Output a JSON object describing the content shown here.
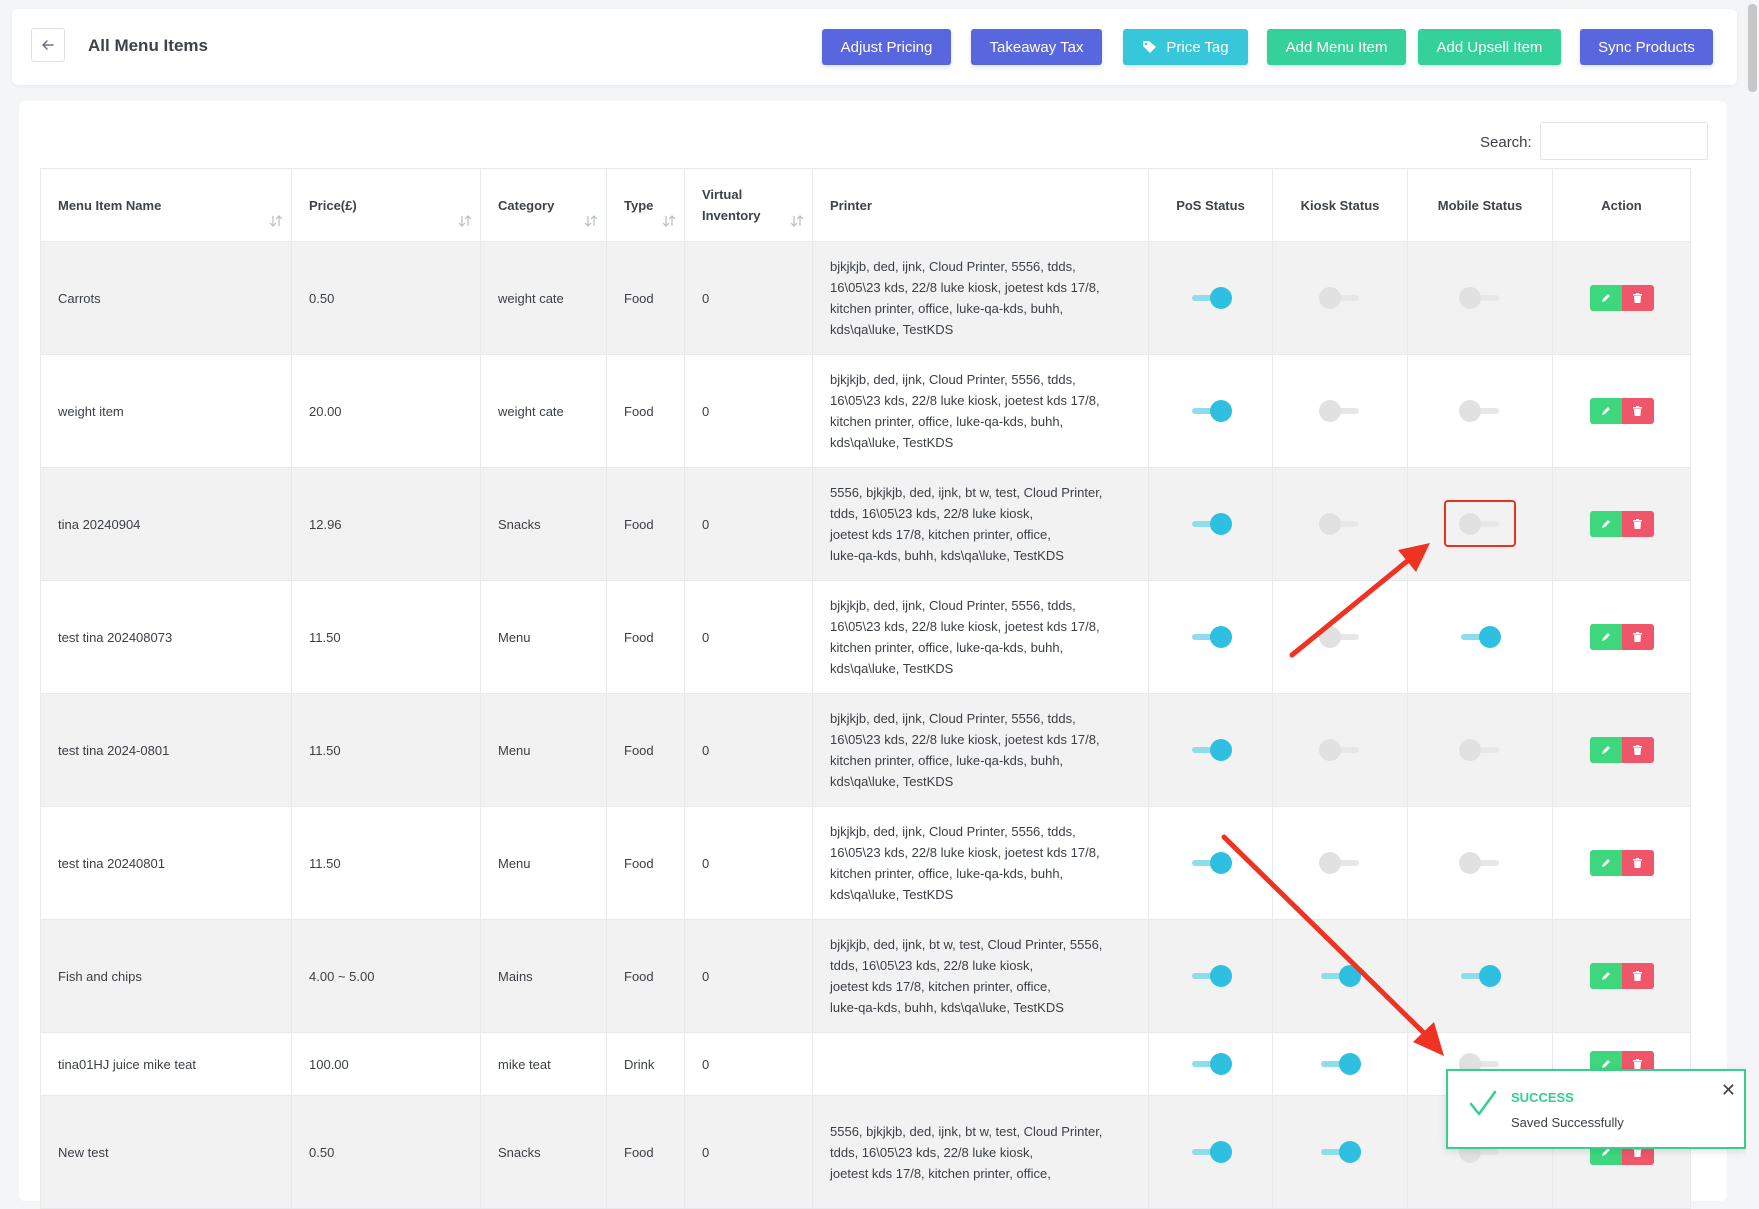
{
  "header": {
    "title": "All Menu Items",
    "buttons": {
      "adjust_pricing": "Adjust Pricing",
      "takeaway_tax": "Takeaway Tax",
      "price_tag": "Price Tag",
      "add_menu_item": "Add Menu Item",
      "add_upsell_item": "Add Upsell Item",
      "sync_products": "Sync Products"
    }
  },
  "search": {
    "label": "Search:",
    "value": ""
  },
  "table": {
    "columns": {
      "name": "Menu Item Name",
      "price": "Price(£)",
      "category": "Category",
      "type": "Type",
      "virtual_inventory_line1": "Virtual",
      "virtual_inventory_line2": "Inventory",
      "printer": "Printer",
      "pos_status": "PoS Status",
      "kiosk_status": "Kiosk Status",
      "mobile_status": "Mobile Status",
      "action": "Action"
    },
    "rows": [
      {
        "name": "Carrots",
        "price": "0.50",
        "category": "weight cate",
        "type": "Food",
        "virtual_inventory": "0",
        "printer_lines": [
          "bjkjkjb, ded, ijnk, Cloud Printer, 5556, tdds,",
          "16\\05\\23 kds, 22/8 luke kiosk, joetest kds 17/8,",
          "kitchen printer, office, luke-qa-kds, buhh,",
          "kds\\qa\\luke, TestKDS"
        ],
        "pos": true,
        "kiosk": false,
        "mobile": false
      },
      {
        "name": "weight item",
        "price": "20.00",
        "category": "weight cate",
        "type": "Food",
        "virtual_inventory": "0",
        "printer_lines": [
          "bjkjkjb, ded, ijnk, Cloud Printer, 5556, tdds,",
          "16\\05\\23 kds, 22/8 luke kiosk, joetest kds 17/8,",
          "kitchen printer, office, luke-qa-kds, buhh,",
          "kds\\qa\\luke, TestKDS"
        ],
        "pos": true,
        "kiosk": false,
        "mobile": false
      },
      {
        "name": "tina 20240904",
        "price": "12.96",
        "category": "Snacks",
        "type": "Food",
        "virtual_inventory": "0",
        "printer_lines": [
          "5556, bjkjkjb, ded, ijnk, bt w, test, Cloud Printer,",
          "tdds, 16\\05\\23 kds, 22/8 luke kiosk,",
          "joetest kds 17/8, kitchen printer, office,",
          "luke-qa-kds, buhh, kds\\qa\\luke, TestKDS"
        ],
        "pos": true,
        "kiosk": false,
        "mobile": false
      },
      {
        "name": "test tina 202408073",
        "price": "11.50",
        "category": "Menu",
        "type": "Food",
        "virtual_inventory": "0",
        "printer_lines": [
          "bjkjkjb, ded, ijnk, Cloud Printer, 5556, tdds,",
          "16\\05\\23 kds, 22/8 luke kiosk, joetest kds 17/8,",
          "kitchen printer, office, luke-qa-kds, buhh,",
          "kds\\qa\\luke, TestKDS"
        ],
        "pos": true,
        "kiosk": false,
        "mobile": true
      },
      {
        "name": "test tina 2024-0801",
        "price": "11.50",
        "category": "Menu",
        "type": "Food",
        "virtual_inventory": "0",
        "printer_lines": [
          "bjkjkjb, ded, ijnk, Cloud Printer, 5556, tdds,",
          "16\\05\\23 kds, 22/8 luke kiosk, joetest kds 17/8,",
          "kitchen printer, office, luke-qa-kds, buhh,",
          "kds\\qa\\luke, TestKDS"
        ],
        "pos": true,
        "kiosk": false,
        "mobile": false
      },
      {
        "name": "test tina 20240801",
        "price": "11.50",
        "category": "Menu",
        "type": "Food",
        "virtual_inventory": "0",
        "printer_lines": [
          "bjkjkjb, ded, ijnk, Cloud Printer, 5556, tdds,",
          "16\\05\\23 kds, 22/8 luke kiosk, joetest kds 17/8,",
          "kitchen printer, office, luke-qa-kds, buhh,",
          "kds\\qa\\luke, TestKDS"
        ],
        "pos": true,
        "kiosk": false,
        "mobile": false
      },
      {
        "name": "Fish and chips",
        "price": "4.00 ~ 5.00",
        "category": "Mains",
        "type": "Food",
        "virtual_inventory": "0",
        "printer_lines": [
          "bjkjkjb, ded, ijnk, bt w, test, Cloud Printer, 5556,",
          "tdds, 16\\05\\23 kds, 22/8 luke kiosk,",
          "joetest kds 17/8, kitchen printer, office,",
          "luke-qa-kds, buhh, kds\\qa\\luke, TestKDS"
        ],
        "pos": true,
        "kiosk": true,
        "mobile": true
      },
      {
        "name": "tina01HJ juice mike teat",
        "price": "100.00",
        "category": "mike teat",
        "type": "Drink",
        "virtual_inventory": "0",
        "printer_lines": [],
        "pos": true,
        "kiosk": true,
        "mobile": false
      },
      {
        "name": "New test",
        "price": "0.50",
        "category": "Snacks",
        "type": "Food",
        "virtual_inventory": "0",
        "printer_lines": [
          "5556, bjkjkjb, ded, ijnk, bt w, test, Cloud Printer,",
          "tdds, 16\\05\\23 kds, 22/8 luke kiosk,",
          "joetest kds 17/8, kitchen printer, office,"
        ],
        "pos": true,
        "kiosk": true,
        "mobile": false
      }
    ]
  },
  "toast": {
    "title": "SUCCESS",
    "message": "Saved Successfully"
  },
  "colors": {
    "primary": "#5867dd",
    "info": "#36c7db",
    "success": "#34d19a",
    "toggle_on": "#2fbfe0",
    "edit": "#3ed77d",
    "delete": "#f0566a",
    "annotation": "#e8331f"
  }
}
